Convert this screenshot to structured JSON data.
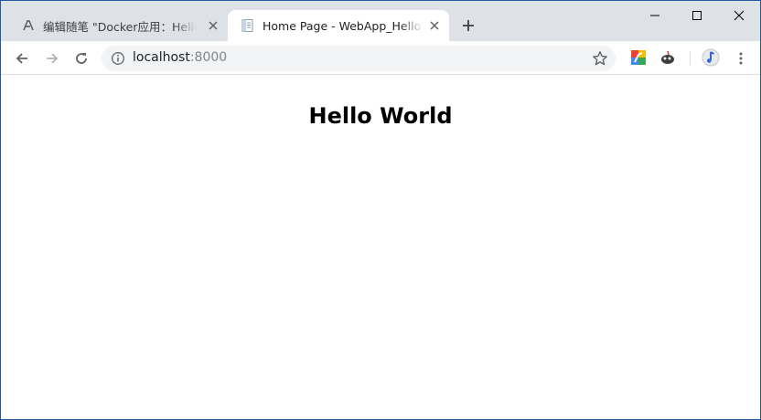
{
  "browser": {
    "tabs": [
      {
        "title": "编辑随笔 \"Docker应用：Hello World",
        "favicon": "pen-icon",
        "active": false
      },
      {
        "title": "Home Page - WebApp_HelloWorld",
        "favicon": "page-icon",
        "active": true
      }
    ],
    "new_tab_icon": "plus-icon",
    "window_controls": [
      "minimize-icon",
      "maximize-icon",
      "close-icon"
    ]
  },
  "toolbar": {
    "nav": [
      "back-arrow-icon",
      "forward-arrow-icon",
      "reload-icon"
    ],
    "url_host": "localhost",
    "url_port": ":8000",
    "site_info_icon": "info-icon",
    "bookmark_icon": "star-icon",
    "extensions": [
      "colorful-extension-icon",
      "dark-extension-icon",
      "music-profile-icon"
    ],
    "menu_icon": "kebab-menu-icon"
  },
  "page": {
    "heading": "Hello World"
  },
  "colors": {
    "tabstrip_bg": "#dee1e6",
    "active_tab_bg": "#ffffff",
    "omnibox_bg": "#f1f3f4",
    "window_border": "#1e5a9e"
  }
}
